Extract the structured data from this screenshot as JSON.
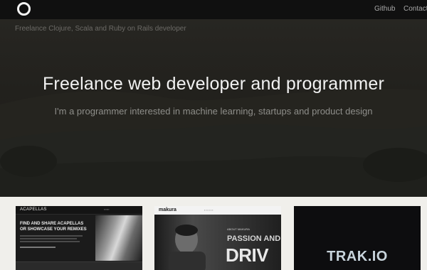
{
  "nav": {
    "github_label": "Github",
    "contact_label": "Contact"
  },
  "hero": {
    "tagline": "Freelance Clojure, Scala and Ruby on Rails developer",
    "title": "Freelance web developer and programmer",
    "subtitle": "I'm a programmer interested in machine learning, startups and product design"
  },
  "portfolio": {
    "acapellas": {
      "brand": "ACAPELLAS",
      "headline_1": "FIND AND SHARE ACAPELLAS",
      "headline_2": "OR SHOWCASE YOUR REMIXES"
    },
    "makura": {
      "brand": "makura",
      "kicker": "ABOUT MAKURA",
      "headline_1": "PASSION AND",
      "headline_2": "DRIV"
    },
    "trakio": {
      "logo": "TRAK.IO"
    }
  },
  "colors": {
    "navbar": "#101010",
    "hero_title": "#f2f2f2",
    "hero_subtitle": "#8e8e8a",
    "strip_background": "#f0efeb"
  }
}
